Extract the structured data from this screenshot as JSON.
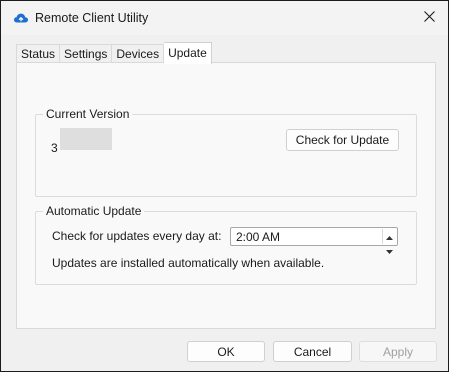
{
  "window": {
    "title": "Remote Client Utility",
    "app_icon": "cloud-sync-icon",
    "close_icon": "close-icon"
  },
  "tabs": [
    {
      "label": "Status",
      "active": false
    },
    {
      "label": "Settings",
      "active": false
    },
    {
      "label": "Devices",
      "active": false
    },
    {
      "label": "Update",
      "active": true
    }
  ],
  "current_version": {
    "group_label": "Current Version",
    "value": "3",
    "check_button_label": "Check for Update"
  },
  "automatic_update": {
    "group_label": "Automatic Update",
    "schedule_label": "Check for updates every day at:",
    "time_value": "2:00 AM",
    "note": "Updates are installed automatically when available."
  },
  "footer": {
    "ok_label": "OK",
    "cancel_label": "Cancel",
    "apply_label": "Apply",
    "apply_enabled": false
  },
  "colors": {
    "accent_icon": "#1f6fd1",
    "window_bg": "#f0f0f0",
    "panel_bg": "#f9f9f9",
    "disabled_text": "#a0a0a0"
  }
}
